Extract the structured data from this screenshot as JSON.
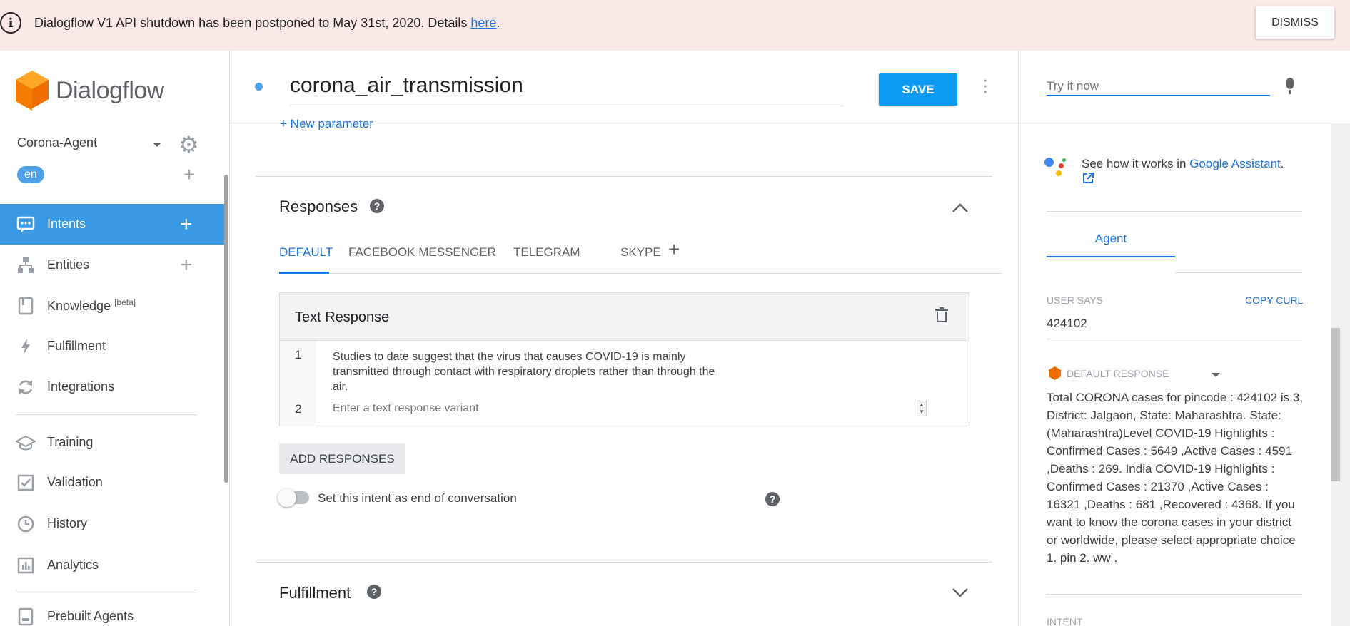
{
  "banner": {
    "message": "Dialogflow V1 API shutdown has been postponed to May 31st, 2020. Details ",
    "link_text": "here",
    "period": ".",
    "dismiss_label": "DISMISS"
  },
  "sidebar": {
    "brand": "Dialogflow",
    "agent_name": "Corona-Agent",
    "language": "en",
    "nav": [
      {
        "label": "Intents",
        "icon": "chat-icon"
      },
      {
        "label": "Entities",
        "icon": "entity-icon"
      },
      {
        "label": "Knowledge",
        "sup": "[beta]",
        "icon": "book-icon"
      },
      {
        "label": "Fulfillment",
        "icon": "bolt-icon"
      },
      {
        "label": "Integrations",
        "icon": "refresh-icon"
      },
      {
        "label": "Training",
        "icon": "graduation-icon"
      },
      {
        "label": "Validation",
        "icon": "check-icon"
      },
      {
        "label": "History",
        "icon": "clock-icon"
      },
      {
        "label": "Analytics",
        "icon": "bar-chart-icon"
      },
      {
        "label": "Prebuilt Agents",
        "icon": "prebuilt-icon"
      }
    ]
  },
  "header": {
    "intent_name": "corona_air_transmission",
    "save_label": "SAVE"
  },
  "main": {
    "new_parameter": "New parameter",
    "responses_title": "Responses",
    "tabs": [
      {
        "label": "DEFAULT"
      },
      {
        "label": "FACEBOOK MESSENGER"
      },
      {
        "label": "TELEGRAM"
      },
      {
        "label": "SKYPE"
      }
    ],
    "text_response_title": "Text Response",
    "rows": [
      {
        "num": "1",
        "text": "Studies to date suggest that the virus that causes COVID-19 is mainly transmitted through contact with respiratory droplets rather than through the air."
      },
      {
        "num": "2",
        "placeholder": "Enter a text response variant"
      }
    ],
    "add_responses": "ADD RESPONSES",
    "end_conversation_label": "Set this intent as end of conversation",
    "fulfillment_title": "Fulfillment"
  },
  "right_panel": {
    "try_placeholder": "Try it now",
    "ga_text": "See how it works in ",
    "ga_link": "Google Assistant",
    "ga_period": ".",
    "agent_tab": "Agent",
    "user_says_label": "USER SAYS",
    "copy_curl": "COPY CURL",
    "user_says_value": "424102",
    "default_response_label": "DEFAULT RESPONSE",
    "default_response_text": "Total CORONA cases for pincode : 424102 is 3, District: Jalgaon, State: Maharashtra. State:(Maharashtra)Level COVID-19 Highlights : Confirmed Cases : 5649 ,Active Cases : 4591 ,Deaths : 269. India COVID-19 Highlights : Confirmed Cases : 21370 ,Active Cases : 16321 ,Deaths : 681 ,Recovered : 4368. If you want to know the corona cases in your district or worldwide, please select appropriate choice 1. pin 2. ww .",
    "intent_label": "INTENT"
  },
  "colors": {
    "accent": "#1a73e8",
    "save_button": "#0d9af5",
    "active_nav": "#3b99e3",
    "banner_bg": "#fbe9e7"
  }
}
